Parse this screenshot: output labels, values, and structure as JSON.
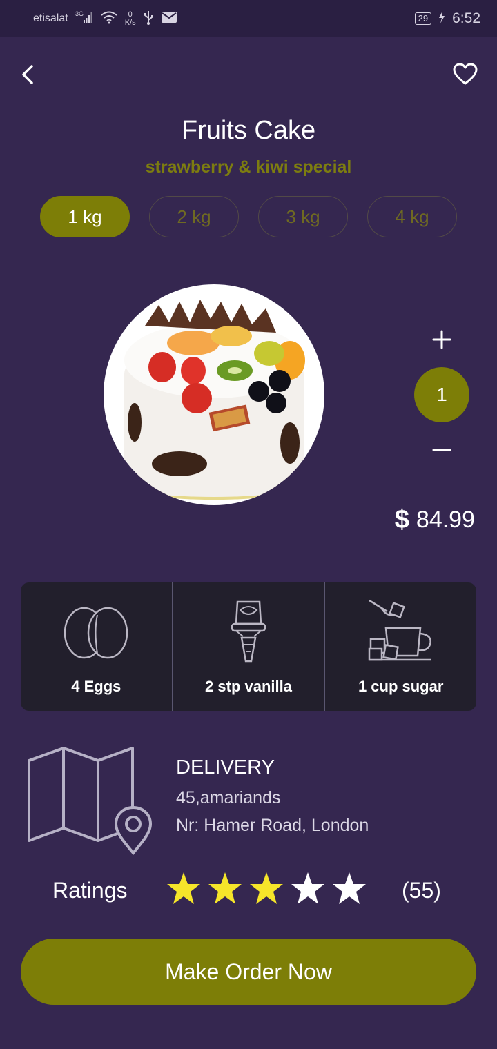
{
  "status_bar": {
    "carrier": "etisalat",
    "network": "3G",
    "speed_value": "0",
    "speed_unit": "K/s",
    "battery": "29",
    "time": "6:52"
  },
  "product": {
    "title": "Fruits Cake",
    "subtitle": "strawberry & kiwi special"
  },
  "weights": [
    {
      "label": "1 kg",
      "selected": true
    },
    {
      "label": "2 kg",
      "selected": false
    },
    {
      "label": "3 kg",
      "selected": false
    },
    {
      "label": "4 kg",
      "selected": false
    }
  ],
  "quantity": {
    "plus": "+",
    "value": "1",
    "minus": "−"
  },
  "price": {
    "currency": "$",
    "amount": "84.99"
  },
  "ingredients": [
    {
      "icon": "eggs-icon",
      "label": "4 Eggs"
    },
    {
      "icon": "ice-cream-icon",
      "label": "2 stp vanilla"
    },
    {
      "icon": "sugar-cup-icon",
      "label": "1 cup sugar"
    }
  ],
  "delivery": {
    "title": "DELIVERY",
    "line1": "45,amariands",
    "line2": "Nr: Hamer Road, London"
  },
  "ratings": {
    "label": "Ratings",
    "stars_filled": 3,
    "stars_total": 5,
    "count": "(55)"
  },
  "cta": {
    "label": "Make Order Now"
  },
  "colors": {
    "background": "#352750",
    "accent": "#7d7e07",
    "star_filled": "#f5e52a",
    "star_empty": "#ffffff"
  }
}
